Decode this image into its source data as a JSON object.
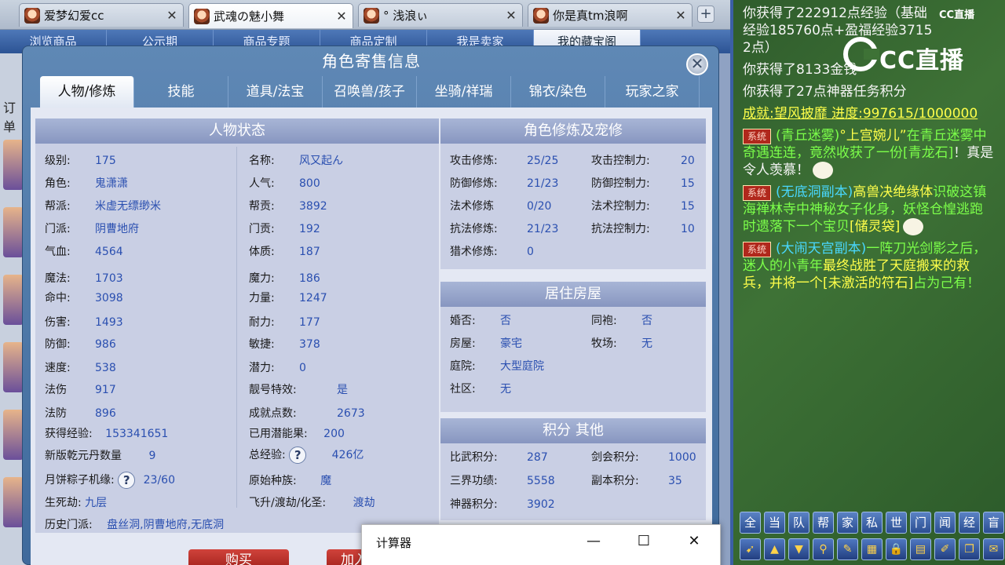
{
  "browser_tabs": [
    {
      "title": "爱梦幻爱cc",
      "active": false
    },
    {
      "title": "武魂の魅小舞",
      "active": true
    },
    {
      "title": "° 浅浪ぃ",
      "active": false
    },
    {
      "title": "你是真tm浪啊",
      "active": false
    }
  ],
  "game_menu": [
    "浏览商品",
    "公示期",
    "商品专题",
    "商品定制",
    "我是卖家",
    "我的藏宝阁"
  ],
  "game_left_label": "订单",
  "dialog": {
    "title": "角色寄售信息",
    "tabs": [
      "人物/修炼",
      "技能",
      "道具/法宝",
      "召唤兽/孩子",
      "坐骑/祥瑞",
      "锦衣/染色",
      "玩家之家"
    ],
    "status_panel": {
      "title": "人物状态",
      "left": [
        {
          "label": "级别:",
          "value": "175"
        },
        {
          "label": "角色:",
          "value": "鬼潇潇"
        },
        {
          "label": "帮派:",
          "value": "米虚无缥缈米"
        },
        {
          "label": "门派:",
          "value": "阴曹地府"
        },
        {
          "label": "气血:",
          "value": "4564"
        },
        {
          "label": "魔法:",
          "value": "1703"
        },
        {
          "label": "命中:",
          "value": "3098"
        },
        {
          "label": "伤害:",
          "value": "1493"
        },
        {
          "label": "防御:",
          "value": "986"
        },
        {
          "label": "速度:",
          "value": "538"
        },
        {
          "label": "法伤",
          "value": "917"
        },
        {
          "label": "法防",
          "value": "896"
        }
      ],
      "right": [
        {
          "label": "名称:",
          "value": "风又起ん"
        },
        {
          "label": "人气:",
          "value": "800"
        },
        {
          "label": "帮贡:",
          "value": "3892"
        },
        {
          "label": "门贡:",
          "value": "192"
        },
        {
          "label": "体质:",
          "value": "187"
        },
        {
          "label": "魔力:",
          "value": "186"
        },
        {
          "label": "力量:",
          "value": "1247"
        },
        {
          "label": "耐力:",
          "value": "177"
        },
        {
          "label": "敏捷:",
          "value": "378"
        },
        {
          "label": "潜力:",
          "value": "0"
        },
        {
          "label": "靓号特效:",
          "value": "是"
        },
        {
          "label": "成就点数:",
          "value": "2673"
        }
      ],
      "extra": {
        "exp_label": "获得经验:",
        "exp_value": "153341651",
        "qianyuan_label": "新版乾元丹数量",
        "qianyuan_value": "9",
        "mooncake_label": "月饼粽子机缘:",
        "mooncake_value": "23/60",
        "life_label": "生死劫:",
        "life_value": "九层",
        "history_label": "历史门派:",
        "history_value": "盘丝洞,阴曹地府,无底洞",
        "used_label": "已用潜能果:",
        "used_value": "200",
        "total_exp_label": "总经验:",
        "total_exp_value": "426亿",
        "race_label": "原始种族:",
        "race_value": "魔",
        "ascend_label": "飞升/渡劫/化圣:",
        "ascend_value": "渡劫"
      }
    },
    "cultivation_panel": {
      "title": "角色修炼及宠修",
      "rows": [
        {
          "l1": "攻击修炼:",
          "v1": "25/25",
          "l2": "攻击控制力:",
          "v2": "20"
        },
        {
          "l1": "防御修炼:",
          "v1": "21/23",
          "l2": "防御控制力:",
          "v2": "15"
        },
        {
          "l1": "法术修炼",
          "v1": "0/20",
          "l2": "法术控制力:",
          "v2": "15"
        },
        {
          "l1": "抗法修炼:",
          "v1": "21/23",
          "l2": "抗法控制力:",
          "v2": "10"
        },
        {
          "l1": "猎术修炼:",
          "v1": "0",
          "l2": "",
          "v2": ""
        }
      ]
    },
    "house_panel": {
      "title": "居住房屋",
      "rows": [
        {
          "l1": "婚否:",
          "v1": "否",
          "l2": "同袍:",
          "v2": "否"
        },
        {
          "l1": "房屋:",
          "v1": "豪宅",
          "l2": "牧场:",
          "v2": "无"
        },
        {
          "l1": "庭院:",
          "v1": "大型庭院",
          "l2": "",
          "v2": ""
        },
        {
          "l1": "社区:",
          "v1": "无",
          "l2": "",
          "v2": ""
        }
      ]
    },
    "score_panel": {
      "title": "积分 其他",
      "rows": [
        {
          "l1": "比武积分:",
          "v1": "287",
          "l2": "剑会积分:",
          "v2": "1000"
        },
        {
          "l1": "三界功绩:",
          "v1": "5558",
          "l2": "副本积分:",
          "v2": "35"
        },
        {
          "l1": "神器积分:",
          "v1": "3902",
          "l2": "",
          "v2": ""
        }
      ]
    },
    "buy_label": "购买",
    "add_label": "加入"
  },
  "calculator": {
    "title": "计算器",
    "min": "—",
    "max": "☐",
    "close": "✕"
  },
  "chat": {
    "logo_small": "CC直播",
    "logo_big": "CC直播",
    "line1": "你获得了222912点经验（基础经验185760点+盈福经验37152点）",
    "line2": "你获得了8133金钱",
    "line3": "你获得了27点神器任务积分",
    "line4": "成就:望风披靡 进度:997615/1000000",
    "sys_tag": "系统",
    "msg1_a": "(青丘迷雾)",
    "msg1_b": "°上宫婉儿”",
    "msg1_c": "在青丘迷雾中奇遇连连，竟然收获了一份",
    "msg1_d": "[青龙石]",
    "msg1_e": "！真是令人羡慕！",
    "msg2_a": "(无底洞副本)",
    "msg2_b": "高兽决绝缘体",
    "msg2_c": "识破这镇海禅林寺中神秘女子化身，妖怪仓惶逃跑时遗落下一个宝贝",
    "msg2_d": "[储灵袋]",
    "msg3_a": "(大闹天宫副本)",
    "msg3_b": "一阵刀光剑影之后，迷人的小青年",
    "msg3_c": "最终战胜了天庭搬来的救兵，并将一个",
    "msg3_d": "[未激活的符石]",
    "msg3_e": "占为己有！",
    "channels": [
      "全",
      "当",
      "队",
      "帮",
      "家",
      "私",
      "世",
      "门",
      "闻",
      "经",
      "盲"
    ]
  }
}
